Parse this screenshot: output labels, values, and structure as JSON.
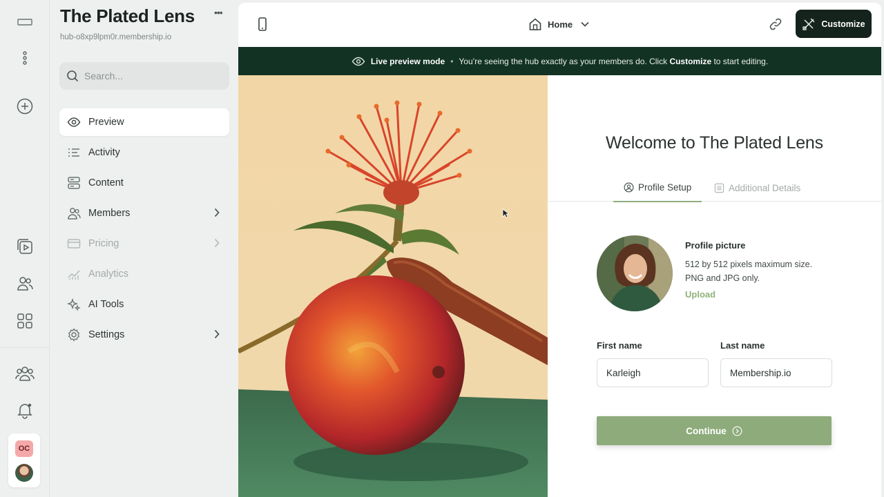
{
  "rail": {
    "icons": [
      "window-icon",
      "more-vertical-icon",
      "add-circle-icon",
      "play-library-icon",
      "members-icon",
      "grid-icon",
      "community-icon",
      "bell-icon"
    ],
    "user_initials": "OC"
  },
  "hub": {
    "title": "The Plated Lens",
    "more": "•••",
    "url": "hub-o8xp9lpm0r.membership.io"
  },
  "search": {
    "placeholder": "Search..."
  },
  "nav": {
    "items": [
      {
        "label": "Preview",
        "icon": "eye-icon",
        "active": true,
        "disabled": false,
        "chevron": false
      },
      {
        "label": "Activity",
        "icon": "activity-list-icon",
        "active": false,
        "disabled": false,
        "chevron": false
      },
      {
        "label": "Content",
        "icon": "content-stack-icon",
        "active": false,
        "disabled": false,
        "chevron": false
      },
      {
        "label": "Members",
        "icon": "members-icon",
        "active": false,
        "disabled": false,
        "chevron": true
      },
      {
        "label": "Pricing",
        "icon": "credit-card-icon",
        "active": false,
        "disabled": true,
        "chevron": true
      },
      {
        "label": "Analytics",
        "icon": "analytics-icon",
        "active": false,
        "disabled": true,
        "chevron": false
      },
      {
        "label": "AI Tools",
        "icon": "sparkles-icon",
        "active": false,
        "disabled": false,
        "chevron": false
      },
      {
        "label": "Settings",
        "icon": "gear-icon",
        "active": false,
        "disabled": false,
        "chevron": true
      }
    ]
  },
  "topbar": {
    "page_selector": "Home",
    "customize_label": "Customize"
  },
  "banner": {
    "mode_label": "Live preview mode",
    "separator": "•",
    "message_prefix": "You’re seeing the hub exactly as your members do. Click ",
    "message_action": "Customize",
    "message_suffix": " to start editing."
  },
  "form": {
    "welcome": "Welcome to The Plated Lens",
    "tabs": [
      {
        "label": "Profile Setup",
        "active": true
      },
      {
        "label": "Additional Details",
        "active": false
      }
    ],
    "profile_picture_title": "Profile picture",
    "profile_picture_line1": "512 by 512 pixels maximum size.",
    "profile_picture_line2": "PNG and JPG only.",
    "upload_label": "Upload",
    "first_name_label": "First name",
    "first_name_value": "Karleigh",
    "last_name_label": "Last name",
    "last_name_value": "Membership.io",
    "continue_label": "Continue"
  },
  "colors": {
    "accent_green": "#8eab7b",
    "dark_green": "#123224",
    "customize_bg": "#14231c",
    "initials_badge": "#f4a8aa"
  }
}
